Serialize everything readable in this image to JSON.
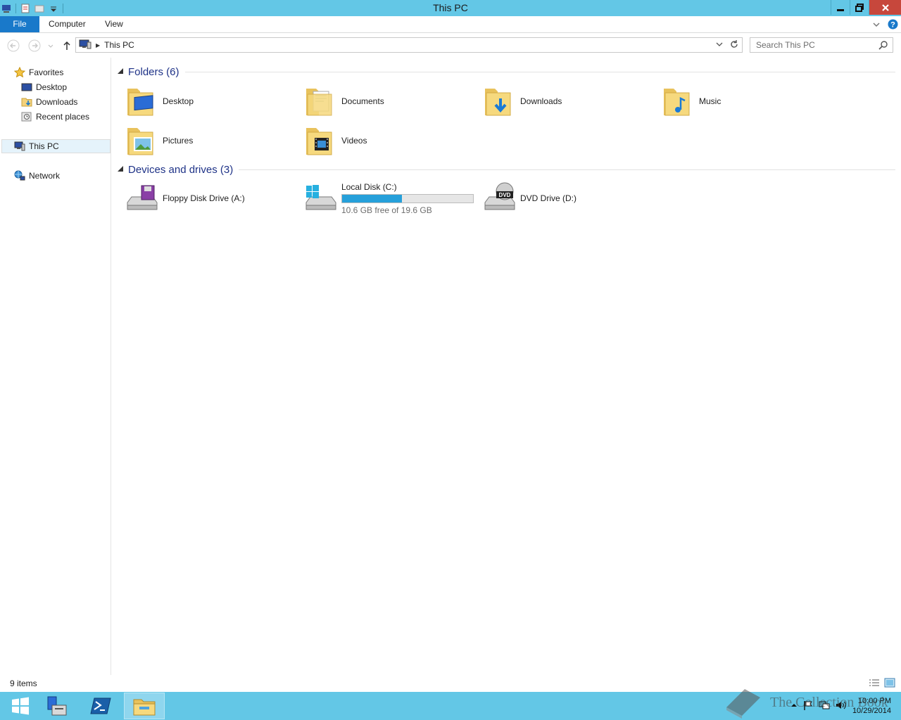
{
  "window": {
    "title": "This PC"
  },
  "ribbon": {
    "tabs": [
      {
        "label": "File"
      },
      {
        "label": "Computer"
      },
      {
        "label": "View"
      }
    ]
  },
  "address": {
    "crumb": "This PC"
  },
  "search": {
    "placeholder": "Search This PC"
  },
  "nav": {
    "favorites": "Favorites",
    "desktop": "Desktop",
    "downloads": "Downloads",
    "recent": "Recent places",
    "this_pc": "This PC",
    "network": "Network"
  },
  "folders_group": {
    "title": "Folders (6)",
    "items": [
      {
        "label": "Desktop",
        "icon": "folder-desktop-icon"
      },
      {
        "label": "Documents",
        "icon": "folder-documents-icon"
      },
      {
        "label": "Downloads",
        "icon": "folder-downloads-icon"
      },
      {
        "label": "Music",
        "icon": "folder-music-icon"
      },
      {
        "label": "Pictures",
        "icon": "folder-pictures-icon"
      },
      {
        "label": "Videos",
        "icon": "folder-videos-icon"
      }
    ]
  },
  "drives_group": {
    "title": "Devices and drives (3)",
    "floppy": {
      "label": "Floppy Disk Drive (A:)"
    },
    "local": {
      "label": "Local Disk (C:)",
      "free_text": "10.6 GB free of 19.6 GB",
      "used_fraction": 0.459
    },
    "dvd": {
      "label": "DVD Drive (D:)"
    }
  },
  "status": {
    "count": "9 items"
  },
  "clock": {
    "time": "10:00 PM",
    "date": "10/29/2014"
  },
  "watermark": {
    "text": "The Collection Book"
  },
  "colors": {
    "titlebar": "#63c7e6",
    "file_tab": "#1979ca",
    "group_title": "#1e3287",
    "drive_fill": "#26a0da"
  }
}
